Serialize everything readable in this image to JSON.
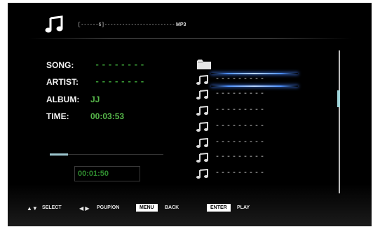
{
  "header": {
    "progress_text": "[------6]------------------------",
    "format": "MP3"
  },
  "info": {
    "song_label": "SONG:",
    "song_value": "--------",
    "artist_label": "ARTIST:",
    "artist_value": "--------",
    "album_label": "ALBUM:",
    "album_value": "JJ",
    "time_label": "TIME:",
    "time_value": "00:03:53"
  },
  "playback": {
    "elapsed": "00:01:50",
    "progress_fraction": 0.16
  },
  "playlist": {
    "items": [
      {
        "title": "---------"
      },
      {
        "title": "---------"
      },
      {
        "title": "---------"
      },
      {
        "title": "---------"
      },
      {
        "title": "---------"
      },
      {
        "title": "---------"
      },
      {
        "title": "---------"
      }
    ],
    "selected_index": 0
  },
  "help": {
    "select_label": "SELECT",
    "page_label": "PGUP/ON",
    "menu_key": "MENU",
    "menu_label": "BACK",
    "enter_key": "ENTER",
    "enter_label": "PLAY"
  },
  "colors": {
    "background": "#000000",
    "accent_green": "#57b84a",
    "highlight_blue": "#4f92ff",
    "progress_fill": "#9dc7cf"
  }
}
